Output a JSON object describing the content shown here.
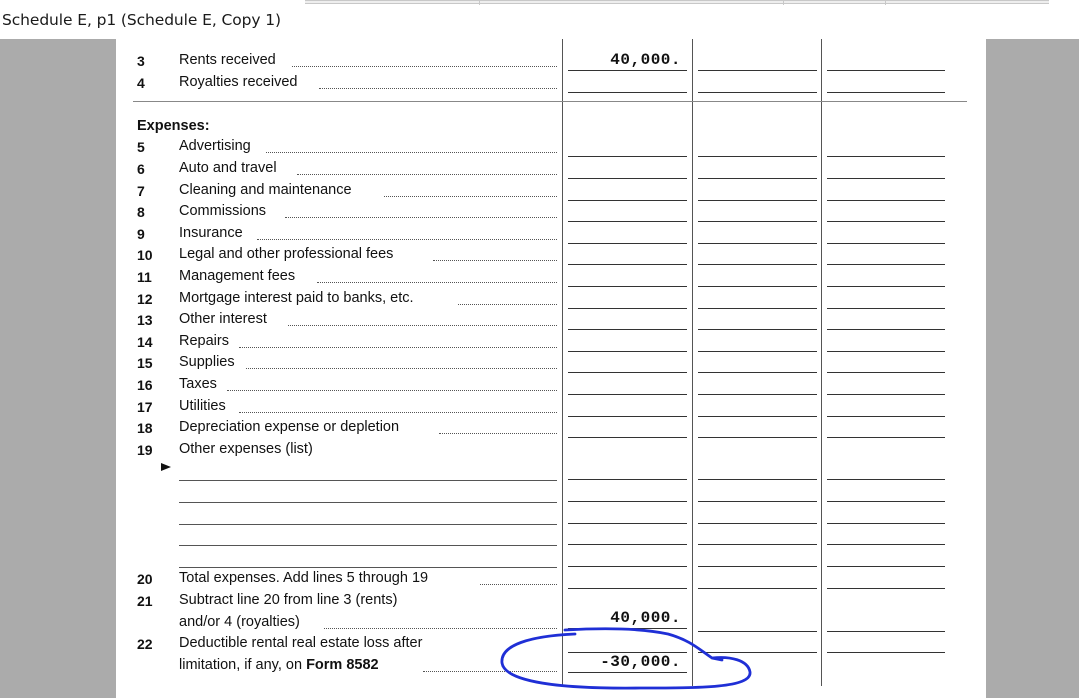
{
  "window": {
    "title": "Schedule E, p1 (Schedule E, Copy 1)"
  },
  "income": [
    {
      "num": "3",
      "label": "Rents received",
      "amount": "40,000."
    },
    {
      "num": "4",
      "label": "Royalties received",
      "amount": ""
    }
  ],
  "expenses_heading": "Expenses:",
  "expenses": [
    {
      "num": "5",
      "label": "Advertising"
    },
    {
      "num": "6",
      "label": "Auto and travel"
    },
    {
      "num": "7",
      "label": "Cleaning and maintenance"
    },
    {
      "num": "8",
      "label": "Commissions"
    },
    {
      "num": "9",
      "label": "Insurance"
    },
    {
      "num": "10",
      "label": "Legal and other professional fees"
    },
    {
      "num": "11",
      "label": "Management fees"
    },
    {
      "num": "12",
      "label": "Mortgage interest paid to banks, etc."
    },
    {
      "num": "13",
      "label": "Other interest"
    },
    {
      "num": "14",
      "label": "Repairs"
    },
    {
      "num": "15",
      "label": "Supplies"
    },
    {
      "num": "16",
      "label": "Taxes"
    },
    {
      "num": "17",
      "label": "Utilities"
    },
    {
      "num": "18",
      "label": "Depreciation expense or depletion"
    },
    {
      "num": "19",
      "label": "Other expenses (list)"
    }
  ],
  "totals": {
    "line20": {
      "num": "20",
      "label": "Total expenses. Add lines 5 through 19",
      "amount": ""
    },
    "line21": {
      "num": "21",
      "label_1": "Subtract line 20 from line 3 (rents)",
      "label_2": "and/or 4 (royalties)",
      "amount": "40,000."
    },
    "line22": {
      "num": "22",
      "label_1": "Deductible rental real estate loss after",
      "label_2_prefix": "limitation, if any, on",
      "label_2_bold": "Form 8582",
      "amount": "-30,000."
    }
  },
  "colors": {
    "gray_surround": "#ababab",
    "annotation": "#1f2fd6"
  },
  "icons": {
    "list_arrow": "right-pointer-icon"
  }
}
